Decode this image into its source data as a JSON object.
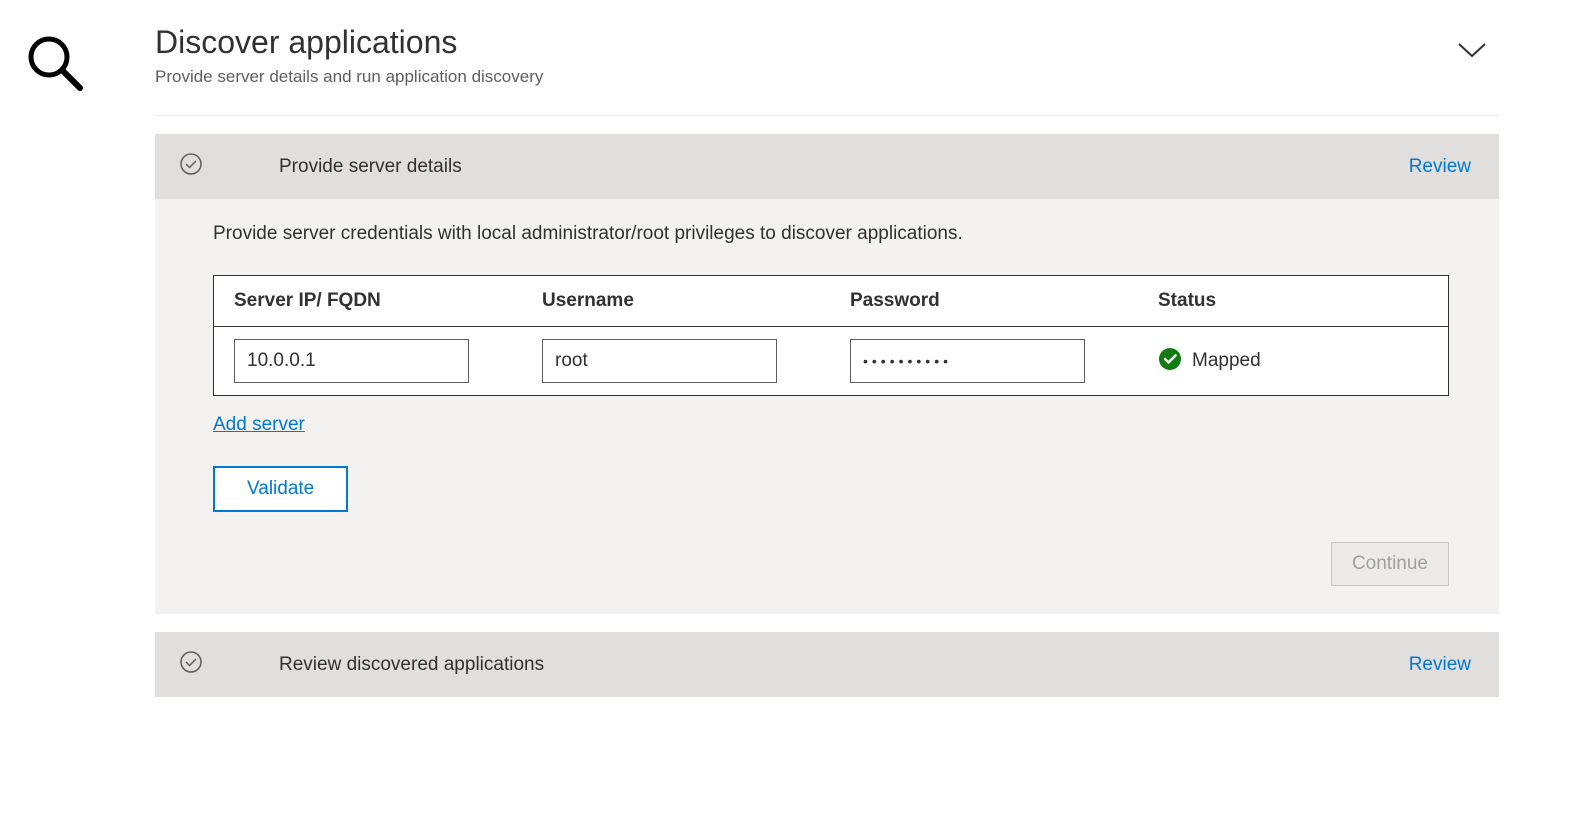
{
  "header": {
    "title": "Discover applications",
    "subtitle": "Provide server details and run application discovery"
  },
  "sections": {
    "provide": {
      "title": "Provide server details",
      "review_label": "Review",
      "instruction": "Provide server credentials with local administrator/root privileges to discover applications.",
      "table": {
        "headers": {
          "ip": "Server IP/ FQDN",
          "username": "Username",
          "password": "Password",
          "status": "Status"
        },
        "row": {
          "ip": "10.0.0.1",
          "username": "root",
          "password": "••••••••••",
          "status": "Mapped"
        }
      },
      "add_server_label": "Add server",
      "validate_label": "Validate",
      "continue_label": "Continue"
    },
    "review": {
      "title": "Review discovered applications",
      "review_label": "Review"
    }
  }
}
